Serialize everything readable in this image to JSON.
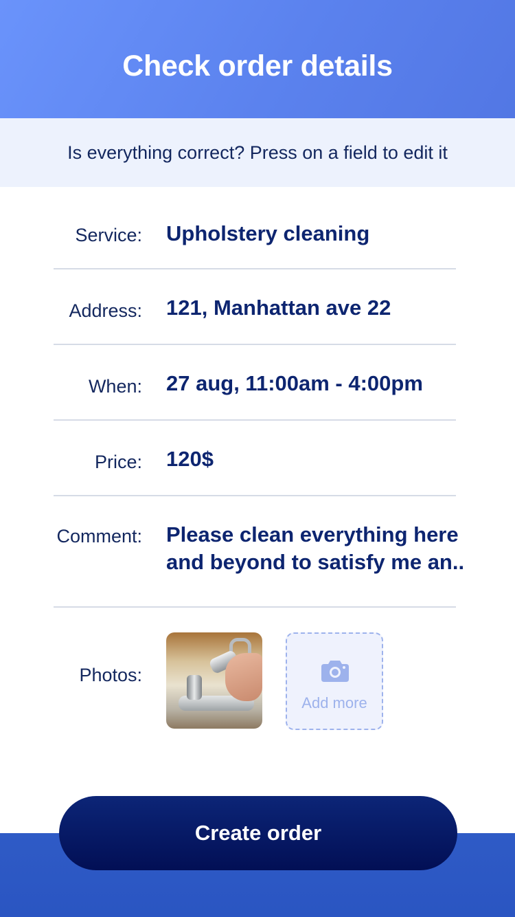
{
  "header": {
    "title": "Check order details"
  },
  "subheader": {
    "text": "Is everything correct? Press on a field to edit it"
  },
  "fields": {
    "service": {
      "label": "Service:",
      "value": "Upholstery cleaning"
    },
    "address": {
      "label": "Address:",
      "value": "121, Manhattan ave 22"
    },
    "when": {
      "label": "When:",
      "value": "27 aug, 11:00am - 4:00pm"
    },
    "price": {
      "label": "Price:",
      "value": "120$"
    },
    "comment": {
      "label": "Comment:",
      "value": "Please clean everything here and beyond to satisfy me an.."
    },
    "photos": {
      "label": "Photos:",
      "add_more_label": "Add more",
      "add_more_icon": "camera-icon"
    }
  },
  "actions": {
    "create_order_label": "Create order"
  },
  "colors": {
    "header_gradient_start": "#6a93fb",
    "header_gradient_end": "#5277e4",
    "subheader_bg": "#edf2fd",
    "text_dark": "#13275e",
    "value_text": "#0d2570",
    "button_bg": "#0c2577",
    "footer_bg": "#2f5bc6",
    "add_more_accent": "#9db2ec"
  }
}
